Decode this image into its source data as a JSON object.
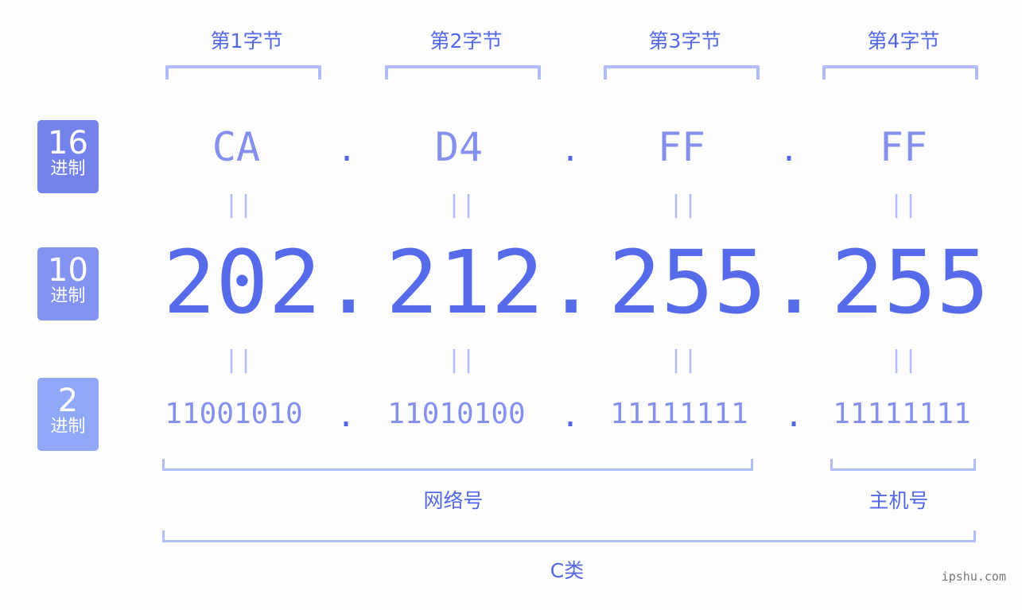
{
  "byte_labels": [
    "第1字节",
    "第2字节",
    "第3字节",
    "第4字节"
  ],
  "badges": [
    {
      "num": "16",
      "unit": "进制",
      "color": "#7483ec"
    },
    {
      "num": "10",
      "unit": "进制",
      "color": "#8393f2"
    },
    {
      "num": "2",
      "unit": "进制",
      "color": "#8fa8f8"
    }
  ],
  "hex": [
    "CA",
    "D4",
    "FF",
    "FF"
  ],
  "decimal": [
    "202",
    "212",
    "255",
    "255"
  ],
  "binary": [
    "11001010",
    "11010100",
    "11111111",
    "11111111"
  ],
  "separator": ".",
  "equals": "||",
  "network_label": "网络号",
  "host_label": "主机号",
  "class_label": "C类",
  "watermark": "ipshu.com",
  "colors": {
    "accent": "#566bea",
    "light": "#b2bcf6",
    "mid": "#8490ec"
  }
}
